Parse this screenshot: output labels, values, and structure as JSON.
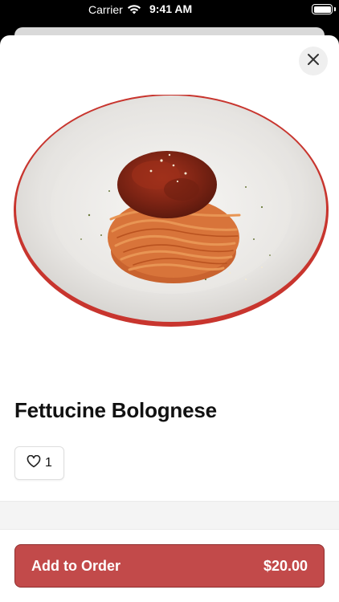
{
  "status_bar": {
    "carrier": "Carrier",
    "time": "9:41 AM",
    "wifi_icon": "wifi-icon",
    "battery_icon": "battery-icon"
  },
  "modal": {
    "close_icon": "close-icon",
    "dish_image_icon": "pasta-plate-image",
    "title": "Fettucine Bolognese",
    "likes": {
      "icon": "heart-icon",
      "count": "1"
    },
    "add_button": {
      "label": "Add to Order",
      "price": "$20.00"
    }
  },
  "colors": {
    "accent": "#c24a4a",
    "accent_border": "#8f2f2f",
    "background": "#ffffff",
    "status_bar": "#000000"
  }
}
